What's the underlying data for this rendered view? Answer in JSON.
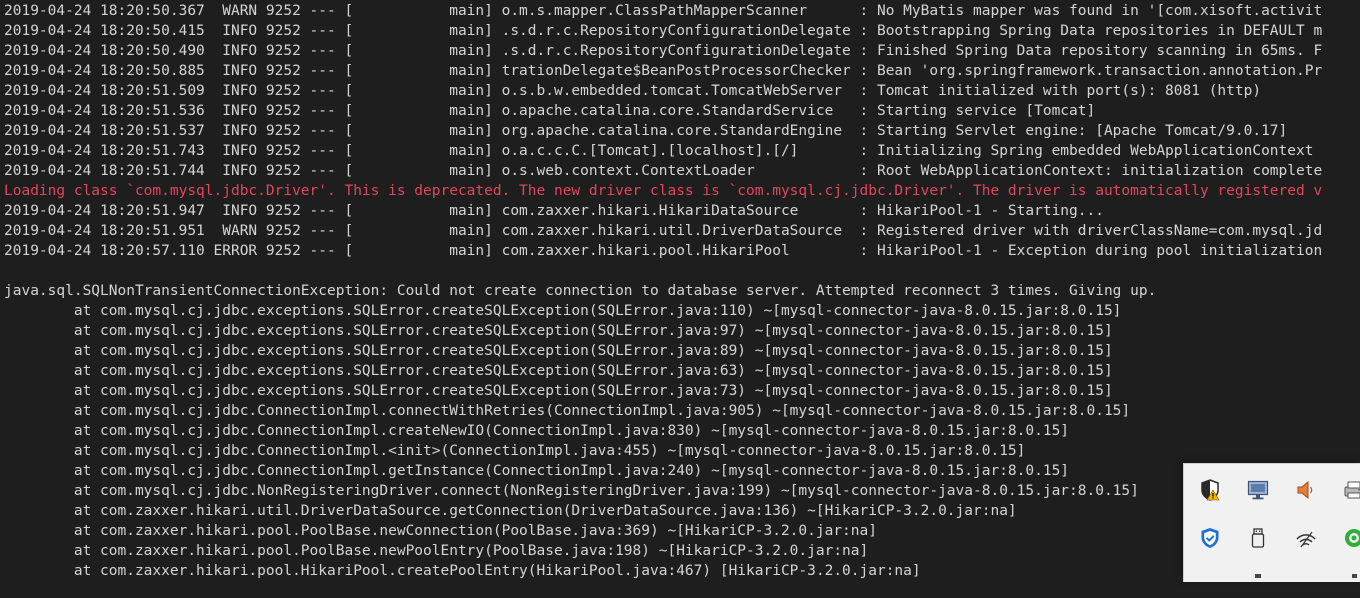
{
  "console": {
    "lines": [
      {
        "text": "2019-04-24 18:20:50.367  WARN 9252 --- [           main] o.m.s.mapper.ClassPathMapperScanner      : No MyBatis mapper was found in '[com.xisoft.activit",
        "color": "default"
      },
      {
        "text": "2019-04-24 18:20:50.415  INFO 9252 --- [           main] .s.d.r.c.RepositoryConfigurationDelegate : Bootstrapping Spring Data repositories in DEFAULT m",
        "color": "default"
      },
      {
        "text": "2019-04-24 18:20:50.490  INFO 9252 --- [           main] .s.d.r.c.RepositoryConfigurationDelegate : Finished Spring Data repository scanning in 65ms. F",
        "color": "default"
      },
      {
        "text": "2019-04-24 18:20:50.885  INFO 9252 --- [           main] trationDelegate$BeanPostProcessorChecker : Bean 'org.springframework.transaction.annotation.Pr",
        "color": "default"
      },
      {
        "text": "2019-04-24 18:20:51.509  INFO 9252 --- [           main] o.s.b.w.embedded.tomcat.TomcatWebServer  : Tomcat initialized with port(s): 8081 (http)",
        "color": "default"
      },
      {
        "text": "2019-04-24 18:20:51.536  INFO 9252 --- [           main] o.apache.catalina.core.StandardService   : Starting service [Tomcat]",
        "color": "default"
      },
      {
        "text": "2019-04-24 18:20:51.537  INFO 9252 --- [           main] org.apache.catalina.core.StandardEngine  : Starting Servlet engine: [Apache Tomcat/9.0.17]",
        "color": "default"
      },
      {
        "text": "2019-04-24 18:20:51.743  INFO 9252 --- [           main] o.a.c.c.C.[Tomcat].[localhost].[/]       : Initializing Spring embedded WebApplicationContext",
        "color": "default"
      },
      {
        "text": "2019-04-24 18:20:51.744  INFO 9252 --- [           main] o.s.web.context.ContextLoader            : Root WebApplicationContext: initialization complete",
        "color": "default"
      },
      {
        "text": "Loading class `com.mysql.jdbc.Driver'. This is deprecated. The new driver class is `com.mysql.cj.jdbc.Driver'. The driver is automatically registered v",
        "color": "red"
      },
      {
        "text": "2019-04-24 18:20:51.947  INFO 9252 --- [           main] com.zaxxer.hikari.HikariDataSource       : HikariPool-1 - Starting...",
        "color": "default"
      },
      {
        "text": "2019-04-24 18:20:51.951  WARN 9252 --- [           main] com.zaxxer.hikari.util.DriverDataSource  : Registered driver with driverClassName=com.mysql.jd",
        "color": "default"
      },
      {
        "text": "2019-04-24 18:20:57.110 ERROR 9252 --- [           main] com.zaxxer.hikari.pool.HikariPool        : HikariPool-1 - Exception during pool initialization",
        "color": "default"
      },
      {
        "text": "",
        "color": "default"
      },
      {
        "text": "java.sql.SQLNonTransientConnectionException: Could not create connection to database server. Attempted reconnect 3 times. Giving up.",
        "color": "default"
      },
      {
        "text": "\tat com.mysql.cj.jdbc.exceptions.SQLError.createSQLException(SQLError.java:110) ~[mysql-connector-java-8.0.15.jar:8.0.15]",
        "color": "default"
      },
      {
        "text": "\tat com.mysql.cj.jdbc.exceptions.SQLError.createSQLException(SQLError.java:97) ~[mysql-connector-java-8.0.15.jar:8.0.15]",
        "color": "default"
      },
      {
        "text": "\tat com.mysql.cj.jdbc.exceptions.SQLError.createSQLException(SQLError.java:89) ~[mysql-connector-java-8.0.15.jar:8.0.15]",
        "color": "default"
      },
      {
        "text": "\tat com.mysql.cj.jdbc.exceptions.SQLError.createSQLException(SQLError.java:63) ~[mysql-connector-java-8.0.15.jar:8.0.15]",
        "color": "default"
      },
      {
        "text": "\tat com.mysql.cj.jdbc.exceptions.SQLError.createSQLException(SQLError.java:73) ~[mysql-connector-java-8.0.15.jar:8.0.15]",
        "color": "default"
      },
      {
        "text": "\tat com.mysql.cj.jdbc.ConnectionImpl.connectWithRetries(ConnectionImpl.java:905) ~[mysql-connector-java-8.0.15.jar:8.0.15]",
        "color": "default"
      },
      {
        "text": "\tat com.mysql.cj.jdbc.ConnectionImpl.createNewIO(ConnectionImpl.java:830) ~[mysql-connector-java-8.0.15.jar:8.0.15]",
        "color": "default"
      },
      {
        "text": "\tat com.mysql.cj.jdbc.ConnectionImpl.<init>(ConnectionImpl.java:455) ~[mysql-connector-java-8.0.15.jar:8.0.15]",
        "color": "default"
      },
      {
        "text": "\tat com.mysql.cj.jdbc.ConnectionImpl.getInstance(ConnectionImpl.java:240) ~[mysql-connector-java-8.0.15.jar:8.0.15]",
        "color": "default"
      },
      {
        "text": "\tat com.mysql.cj.jdbc.NonRegisteringDriver.connect(NonRegisteringDriver.java:199) ~[mysql-connector-java-8.0.15.jar:8.0.15]",
        "color": "default"
      },
      {
        "text": "\tat com.zaxxer.hikari.util.DriverDataSource.getConnection(DriverDataSource.java:136) ~[HikariCP-3.2.0.jar:na]",
        "color": "default"
      },
      {
        "text": "\tat com.zaxxer.hikari.pool.PoolBase.newConnection(PoolBase.java:369) ~[HikariCP-3.2.0.jar:na]",
        "color": "default"
      },
      {
        "text": "\tat com.zaxxer.hikari.pool.PoolBase.newPoolEntry(PoolBase.java:198) ~[HikariCP-3.2.0.jar:na]",
        "color": "default"
      },
      {
        "text": "\tat com.zaxxer.hikari.pool.HikariPool.createPoolEntry(HikariPool.java:467) [HikariCP-3.2.0.jar:na]",
        "color": "default"
      }
    ]
  },
  "colors": {
    "background": "#1e1e1e",
    "text": "#d4d4d4",
    "error_text": "#e3455b",
    "tray_background": "#f1f1f1"
  },
  "tray": {
    "icons": [
      {
        "name": "windows-security-icon"
      },
      {
        "name": "display-icon"
      },
      {
        "name": "volume-icon"
      },
      {
        "name": "printer-icon"
      },
      {
        "name": "defender-shield-icon"
      },
      {
        "name": "usb-drive-icon"
      },
      {
        "name": "wifi-icon"
      },
      {
        "name": "green-status-icon"
      },
      {
        "name": "tray-icon-partial"
      }
    ]
  }
}
